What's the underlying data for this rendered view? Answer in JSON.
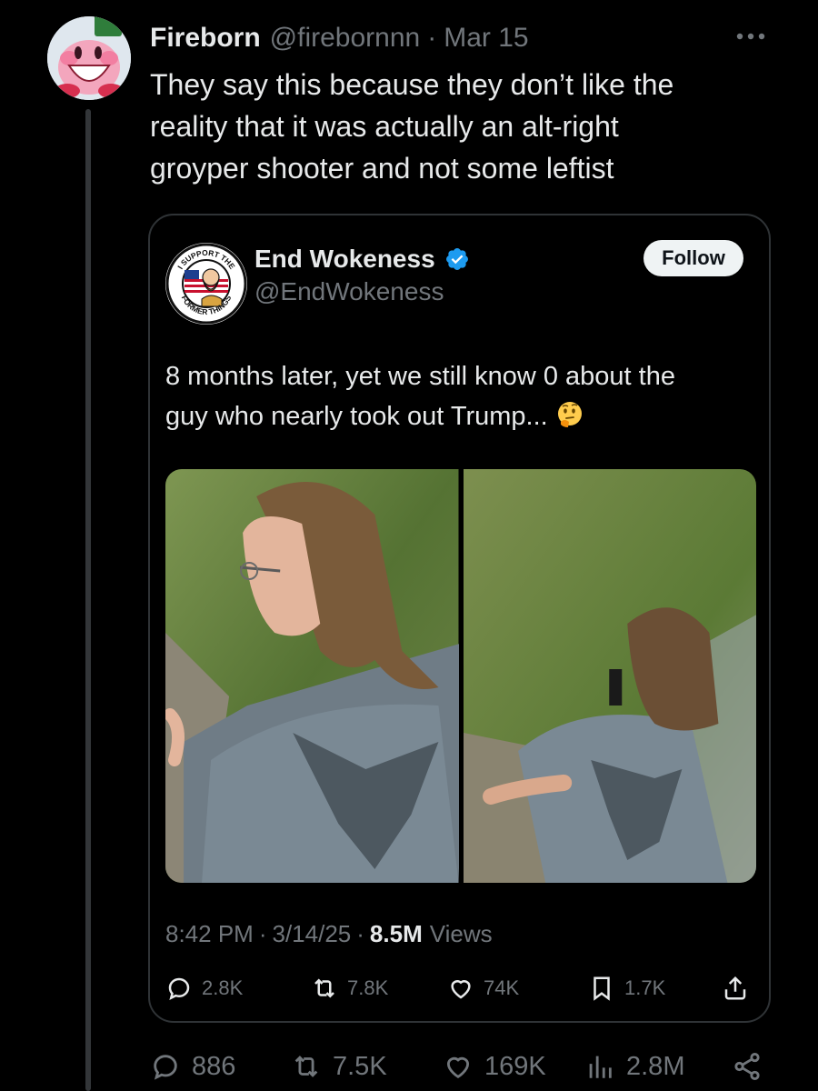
{
  "tweet": {
    "author_name": "Fireborn",
    "author_handle": "@firebornnn",
    "separator": "·",
    "date": "Mar 15",
    "text": "They say this because they don’t like the\nreality that it was actually an alt-right\ngroyper shooter and not some leftist",
    "actions": {
      "replies": "886",
      "reposts": "7.5K",
      "likes": "169K",
      "views": "2.8M"
    },
    "icons": [
      "more-icon",
      "reply-icon",
      "repost-icon",
      "like-icon",
      "views-icon",
      "share-icon"
    ]
  },
  "quote": {
    "author_name": "End Wokeness",
    "author_handle": "@EndWokeness",
    "verified": true,
    "follow_label": "Follow",
    "avatar_text_top": "I SUPPORT THE",
    "avatar_text_bottom": "FORMER THINGS",
    "text": "8 months later, yet we still know 0 about the\nguy who nearly took out Trump...",
    "emoji": "thinking-face",
    "time": "8:42 PM",
    "date": "3/14/25",
    "views_count": "8.5M",
    "views_label": "Views",
    "separator": "·",
    "actions": {
      "replies": "2.8K",
      "reposts": "7.8K",
      "likes": "74K",
      "bookmarks": "1.7K"
    }
  },
  "colors": {
    "background": "#000000",
    "text_primary": "#e7e9ea",
    "text_secondary": "#71767b",
    "border": "#2f3336",
    "verified_blue": "#1d9bf0",
    "follow_bg": "#eff3f4"
  }
}
